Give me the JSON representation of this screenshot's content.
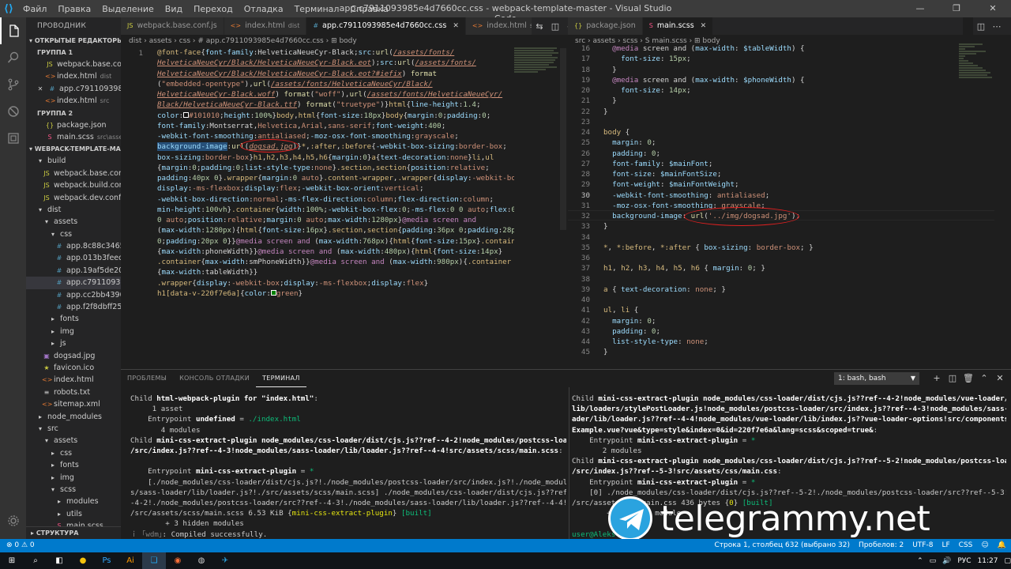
{
  "window": {
    "title": "app.c7911093985e4d7660cc.css - webpack-template-master - Visual Studio Code",
    "menu": [
      "Файл",
      "Правка",
      "Выделение",
      "Вид",
      "Переход",
      "Отладка",
      "Терминал",
      "Справка"
    ],
    "controls": [
      "—",
      "❐",
      "✕"
    ]
  },
  "sidebar": {
    "title": "ПРОВОДНИК",
    "open_editors_header": "ОТКРЫТЫЕ РЕДАКТОРЫ",
    "group1": "ГРУППА 1",
    "group1_items": [
      {
        "icon": "JS",
        "icon_class": "ic-js",
        "label": "webpack.base.con...",
        "desc": ""
      },
      {
        "icon": "<>",
        "icon_class": "ic-html",
        "label": "index.html",
        "desc": "dist"
      },
      {
        "icon": "#",
        "icon_class": "ic-css",
        "label": "app.c7911093985...",
        "desc": "",
        "close": "✕"
      },
      {
        "icon": "<>",
        "icon_class": "ic-html",
        "label": "index.html",
        "desc": "src"
      }
    ],
    "group2": "ГРУППА 2",
    "group2_items": [
      {
        "icon": "{}",
        "icon_class": "ic-json",
        "label": "package.json",
        "desc": ""
      },
      {
        "icon": "S",
        "icon_class": "ic-scss",
        "label": "main.scss",
        "desc": "src\\asset..."
      }
    ],
    "project_header": "WEBPACK-TEMPLATE-MAS...",
    "tree": [
      {
        "depth": 0,
        "chev": "▾",
        "icon": "",
        "icon_class": "ic-folder",
        "label": "build"
      },
      {
        "depth": 1,
        "chev": "",
        "icon": "JS",
        "icon_class": "ic-js",
        "label": "webpack.base.conf.js"
      },
      {
        "depth": 1,
        "chev": "",
        "icon": "JS",
        "icon_class": "ic-js",
        "label": "webpack.build.conf.js"
      },
      {
        "depth": 1,
        "chev": "",
        "icon": "JS",
        "icon_class": "ic-js",
        "label": "webpack.dev.conf.js"
      },
      {
        "depth": 0,
        "chev": "▾",
        "icon": "",
        "icon_class": "ic-folder",
        "label": "dist"
      },
      {
        "depth": 1,
        "chev": "▾",
        "icon": "",
        "icon_class": "ic-folder",
        "label": "assets"
      },
      {
        "depth": 2,
        "chev": "▾",
        "icon": "",
        "icon_class": "ic-folder",
        "label": "css"
      },
      {
        "depth": 3,
        "chev": "",
        "icon": "#",
        "icon_class": "ic-css",
        "label": "app.8c88c346556..."
      },
      {
        "depth": 3,
        "chev": "",
        "icon": "#",
        "icon_class": "ic-css",
        "label": "app.013b3feede9..."
      },
      {
        "depth": 3,
        "chev": "",
        "icon": "#",
        "icon_class": "ic-css",
        "label": "app.19af5de206e..."
      },
      {
        "depth": 3,
        "chev": "",
        "icon": "#",
        "icon_class": "ic-css",
        "label": "app.c7911093985...",
        "selected": true
      },
      {
        "depth": 3,
        "chev": "",
        "icon": "#",
        "icon_class": "ic-css",
        "label": "app.cc2bb43901e..."
      },
      {
        "depth": 3,
        "chev": "",
        "icon": "#",
        "icon_class": "ic-css",
        "label": "app.f2f8dbff25a5..."
      },
      {
        "depth": 2,
        "chev": "▸",
        "icon": "",
        "icon_class": "ic-folder",
        "label": "fonts"
      },
      {
        "depth": 2,
        "chev": "▸",
        "icon": "",
        "icon_class": "ic-folder",
        "label": "img"
      },
      {
        "depth": 2,
        "chev": "▸",
        "icon": "",
        "icon_class": "ic-folder",
        "label": "js"
      },
      {
        "depth": 1,
        "chev": "",
        "icon": "▣",
        "icon_class": "ic-img",
        "label": "dogsad.jpg"
      },
      {
        "depth": 1,
        "chev": "",
        "icon": "★",
        "icon_class": "ic-js",
        "label": "favicon.ico"
      },
      {
        "depth": 1,
        "chev": "",
        "icon": "<>",
        "icon_class": "ic-html",
        "label": "index.html"
      },
      {
        "depth": 1,
        "chev": "",
        "icon": "≡",
        "icon_class": "ic-folder",
        "label": "robots.txt"
      },
      {
        "depth": 1,
        "chev": "",
        "icon": "<>",
        "icon_class": "ic-html",
        "label": "sitemap.xml"
      },
      {
        "depth": 0,
        "chev": "▸",
        "icon": "",
        "icon_class": "ic-folder",
        "label": "node_modules"
      },
      {
        "depth": 0,
        "chev": "▾",
        "icon": "",
        "icon_class": "ic-folder",
        "label": "src"
      },
      {
        "depth": 1,
        "chev": "▾",
        "icon": "",
        "icon_class": "ic-folder",
        "label": "assets"
      },
      {
        "depth": 2,
        "chev": "▸",
        "icon": "",
        "icon_class": "ic-folder",
        "label": "css"
      },
      {
        "depth": 2,
        "chev": "▸",
        "icon": "",
        "icon_class": "ic-folder",
        "label": "fonts"
      },
      {
        "depth": 2,
        "chev": "▸",
        "icon": "",
        "icon_class": "ic-folder",
        "label": "img"
      },
      {
        "depth": 2,
        "chev": "▾",
        "icon": "",
        "icon_class": "ic-folder",
        "label": "scss"
      },
      {
        "depth": 3,
        "chev": "▸",
        "icon": "",
        "icon_class": "ic-folder",
        "label": "modules"
      },
      {
        "depth": 3,
        "chev": "▸",
        "icon": "",
        "icon_class": "ic-folder",
        "label": "utils"
      },
      {
        "depth": 3,
        "chev": "",
        "icon": "S",
        "icon_class": "ic-scss",
        "label": "main.scss"
      }
    ],
    "outline_header": "СТРУКТУРА"
  },
  "editor_left": {
    "tabs": [
      {
        "icon": "JS",
        "icon_class": "ic-js",
        "label": "webpack.base.conf.js",
        "desc": "",
        "active": false
      },
      {
        "icon": "<>",
        "icon_class": "ic-html",
        "label": "index.html",
        "desc": "dist",
        "active": false
      },
      {
        "icon": "#",
        "icon_class": "ic-css",
        "label": "app.c7911093985e4d7660cc.css",
        "desc": "",
        "active": true,
        "close": "✕"
      },
      {
        "icon": "<>",
        "icon_class": "ic-html",
        "label": "index.html",
        "desc": "src",
        "active": false
      }
    ],
    "actions": [
      "⇆",
      "◫",
      "⋯"
    ],
    "breadcrumb": "dist › assets › css › # app.c7911093985e4d7660cc.css › ⊞ body",
    "line_numbers": [
      "1"
    ]
  },
  "editor_right": {
    "tabs": [
      {
        "icon": "{}",
        "icon_class": "ic-json",
        "label": "package.json",
        "desc": "",
        "active": false
      },
      {
        "icon": "S",
        "icon_class": "ic-scss",
        "label": "main.scss",
        "desc": "",
        "active": true,
        "close": "✕"
      }
    ],
    "actions": [
      "◫",
      "⋯"
    ],
    "breadcrumb": "src › assets › scss › S main.scss › ⊞ body",
    "line_numbers": [
      "16",
      "17",
      "18",
      "19",
      "20",
      "21",
      "22",
      "23",
      "24",
      "25",
      "26",
      "27",
      "28",
      "29",
      "30",
      "31",
      "32",
      "33",
      "34",
      "35",
      "36",
      "37",
      "38",
      "39",
      "40",
      "41",
      "42",
      "43",
      "44",
      "45"
    ],
    "current_line": "30"
  },
  "panel": {
    "tabs": [
      "ПРОБЛЕМЫ",
      "КОНСОЛЬ ОТЛАДКИ",
      "ТЕРМИНАЛ"
    ],
    "active_tab": "ТЕРМИНАЛ",
    "terminal_select": "1: bash, bash",
    "actions": [
      "+",
      "◫",
      "🗑",
      "⌃",
      "✕"
    ]
  },
  "watermark": {
    "text": "telegrammy.net"
  },
  "status": {
    "left": "⊗ 0  ⚠ 0",
    "right": [
      "Строка 1, столбец 632 (выбрано 32)",
      "Пробелов: 2",
      "UTF-8",
      "LF",
      "CSS",
      "☺",
      "🔔"
    ]
  },
  "taskbar": {
    "apps": [
      "⊞",
      "⌕",
      "◧",
      "●",
      "Ps",
      "Ai",
      "❏",
      "◉",
      "◍",
      "✈"
    ],
    "tray": [
      "⌃",
      "▭",
      "🔊",
      "РУС",
      "11:27",
      "▢"
    ]
  },
  "colors": {
    "accent": "#007acc",
    "annotation": "#e02020"
  }
}
